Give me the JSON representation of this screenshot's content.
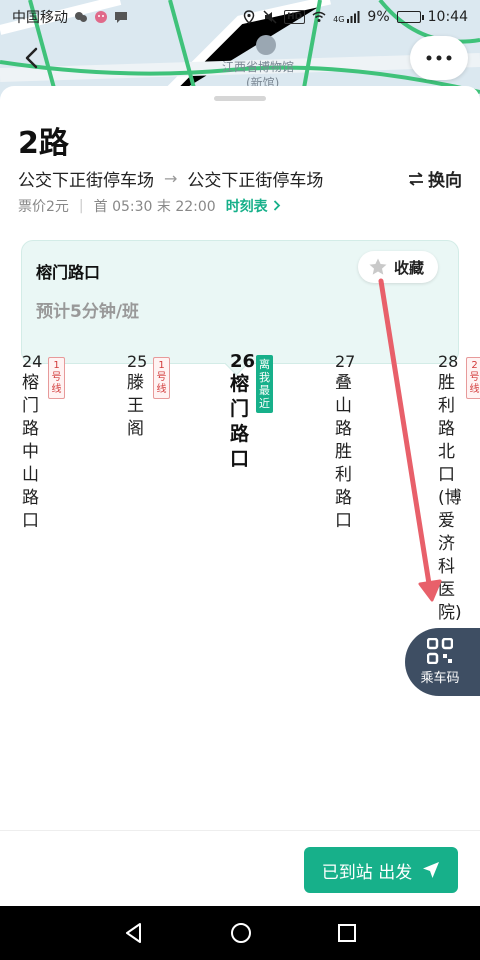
{
  "status_bar": {
    "carrier": "中国移动",
    "hd": "HD",
    "network": "4G",
    "battery_percent": "9%",
    "time": "10:44"
  },
  "map": {
    "poi_name": "江西省博物馆",
    "poi_sub": "(新馆)"
  },
  "route": {
    "title": "2路",
    "from": "公交下正街停车场",
    "arrow": "→",
    "to": "公交下正街停车场",
    "switch_label": "换向",
    "fare": "票价2元",
    "schedule": "首 05:30 末 22:00",
    "timetable_label": "时刻表"
  },
  "station_card": {
    "name": "榕门路口",
    "eta": "预计5分钟/班",
    "favorite_label": "收藏"
  },
  "stations": [
    {
      "num": "24",
      "name": "榕门路中山路口",
      "metro": "1号线"
    },
    {
      "num": "25",
      "name": "滕王阁",
      "metro": "1号线"
    },
    {
      "num": "26",
      "name": "榕门路口",
      "near": "离我最近"
    },
    {
      "num": "27",
      "name": "叠山路胜利路口"
    },
    {
      "num": "28",
      "name": "胜利路北口(博爱济科医院)",
      "metro": "2号线"
    }
  ],
  "ride_code": {
    "label": "乘车码"
  },
  "bottom": {
    "depart_label": "已到站 出发"
  },
  "colors": {
    "accent": "#17b08a",
    "route_line": "#7ea4f0",
    "metro_red": "#d23b3b",
    "ride_code_bg": "#3e4e63",
    "annotation_arrow": "#e8606a"
  }
}
